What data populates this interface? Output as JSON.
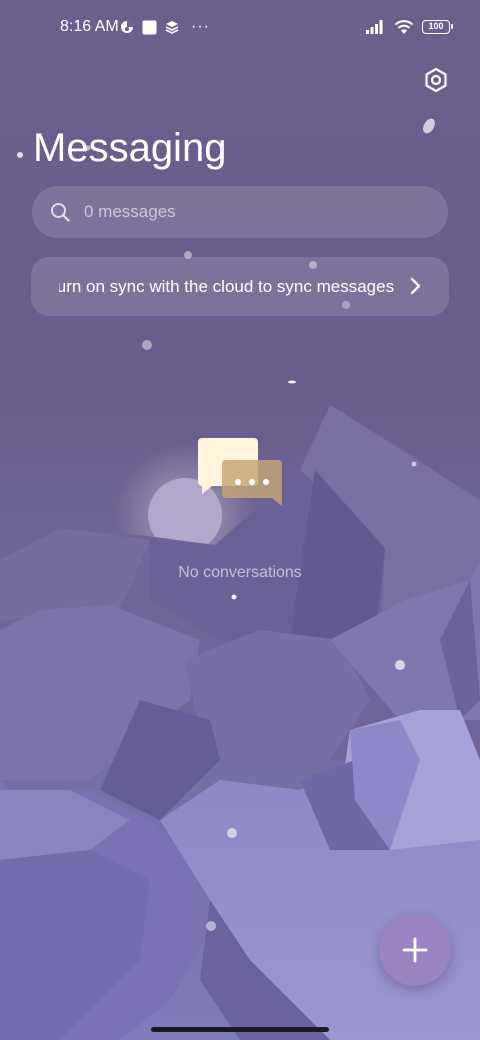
{
  "status_bar": {
    "time": "8:16 AM",
    "battery": "100",
    "more": "···",
    "icons": [
      "circle-half-icon",
      "square-app-icon",
      "layers-icon",
      "signal-icon",
      "wifi-icon",
      "battery-icon"
    ]
  },
  "header": {
    "title": "Messaging",
    "settings_icon": "settings-icon"
  },
  "search": {
    "placeholder": "0 messages",
    "value": ""
  },
  "sync_banner": {
    "text": "Turn on sync with the cloud to sync messages"
  },
  "empty_state": {
    "text": "No conversations",
    "icon": "chat-bubbles-icon"
  },
  "fab": {
    "label": "+",
    "icon": "plus-icon"
  },
  "colors": {
    "background_top": "#6c5e8d",
    "background_bottom": "#7f7cbb",
    "fab": "#9a85c2",
    "text": "#ffffff"
  }
}
